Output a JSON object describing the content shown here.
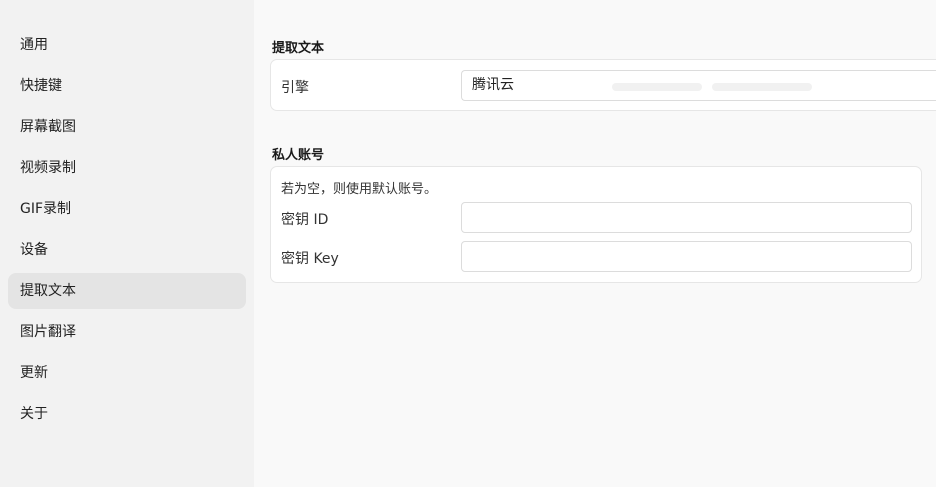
{
  "sidebar": {
    "items": [
      {
        "label": "通用"
      },
      {
        "label": "快捷键"
      },
      {
        "label": "屏幕截图"
      },
      {
        "label": "视频录制"
      },
      {
        "label": "GIF录制"
      },
      {
        "label": "设备"
      },
      {
        "label": "提取文本",
        "active": true
      },
      {
        "label": "图片翻译"
      },
      {
        "label": "更新"
      },
      {
        "label": "关于"
      }
    ]
  },
  "extract_text": {
    "title": "提取文本",
    "engine_label": "引擎",
    "engine_value": "腾讯云"
  },
  "private_account": {
    "title": "私人账号",
    "hint": "若为空，则使用默认账号。",
    "secret_id_label": "密钥 ID",
    "secret_id_value": "",
    "secret_key_label": "密钥 Key",
    "secret_key_value": ""
  },
  "colors": {
    "sidebar_bg": "#f2f2f2",
    "content_bg": "#f9f9f9",
    "active_item_bg": "#e4e4e4",
    "card_bg": "#ffffff",
    "border": "#e6e6e6"
  }
}
